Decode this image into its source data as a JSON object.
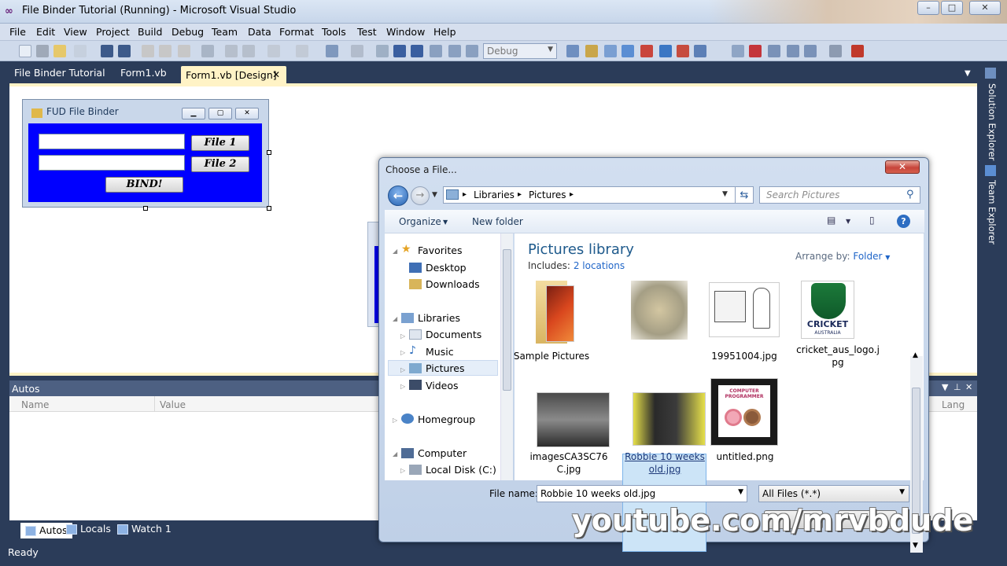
{
  "window": {
    "title": "File Binder Tutorial (Running) - Microsoft Visual Studio",
    "minimize_label": "–",
    "maximize_label": "□",
    "close_label": "✕"
  },
  "menu": [
    "File",
    "Edit",
    "View",
    "Project",
    "Build",
    "Debug",
    "Team",
    "Data",
    "Format",
    "Tools",
    "Test",
    "Window",
    "Help"
  ],
  "toolbar": {
    "config_value": "Debug"
  },
  "doc_tabs": {
    "tab1": "File Binder Tutorial",
    "tab2": "Form1.vb",
    "active": "Form1.vb [Design]",
    "close": "✕"
  },
  "designed_form": {
    "title": "FUD File Binder",
    "button1": "File 1",
    "button2": "File 2",
    "bind": "BIND!"
  },
  "autos": {
    "title": "Autos",
    "col_name": "Name",
    "col_value": "Value",
    "col_lang": "Lang"
  },
  "bottom_tabs": {
    "autos": "Autos",
    "locals": "Locals",
    "watch": "Watch 1"
  },
  "side_tabs": {
    "solution_explorer": "Solution Explorer",
    "team_explorer": "Team Explorer"
  },
  "status": {
    "text": "Ready"
  },
  "dialog": {
    "title": "Choose a File...",
    "close": "✕",
    "breadcrumb": [
      "Libraries",
      "Pictures"
    ],
    "search_placeholder": "Search Pictures",
    "organize": "Organize",
    "new_folder": "New folder",
    "help": "?",
    "library_title": "Pictures library",
    "includes_label": "Includes:",
    "includes_link": "2 locations",
    "arrange_label": "Arrange by:",
    "arrange_value": "Folder",
    "nav": {
      "favorites": "Favorites",
      "desktop": "Desktop",
      "downloads": "Downloads",
      "libraries": "Libraries",
      "documents": "Documents",
      "music": "Music",
      "pictures": "Pictures",
      "videos": "Videos",
      "homegroup": "Homegroup",
      "computer": "Computer",
      "local_disk": "Local Disk (C:)"
    },
    "files": {
      "f1": "Sample Pictures",
      "f2": "",
      "f3": "19951004.jpg",
      "f4a": "cricket_aus_logo.j",
      "f4b": "pg",
      "f5a": "imagesCA3SC76",
      "f5b": "C.jpg",
      "f6a": "Robbie 10 weeks",
      "f6b": "old.jpg",
      "f7": "untitled.png",
      "cricket_logo_text": "CRICKET",
      "cricket_logo_sub": "AUSTRALIA",
      "computer_text": "COMPUTER PROGRAMMER"
    },
    "filename_label": "File name:",
    "filename_value": "Robbie 10 weeks old.jpg",
    "filter_value": "All Files (*.*)"
  },
  "watermark": "youtube.com/mrvbdude",
  "colors": {
    "ide_dark": "#2b3c59",
    "designer_yellow": "#fff3c6",
    "form_blue": "#0000ff",
    "accent_link": "#1f65c8"
  }
}
